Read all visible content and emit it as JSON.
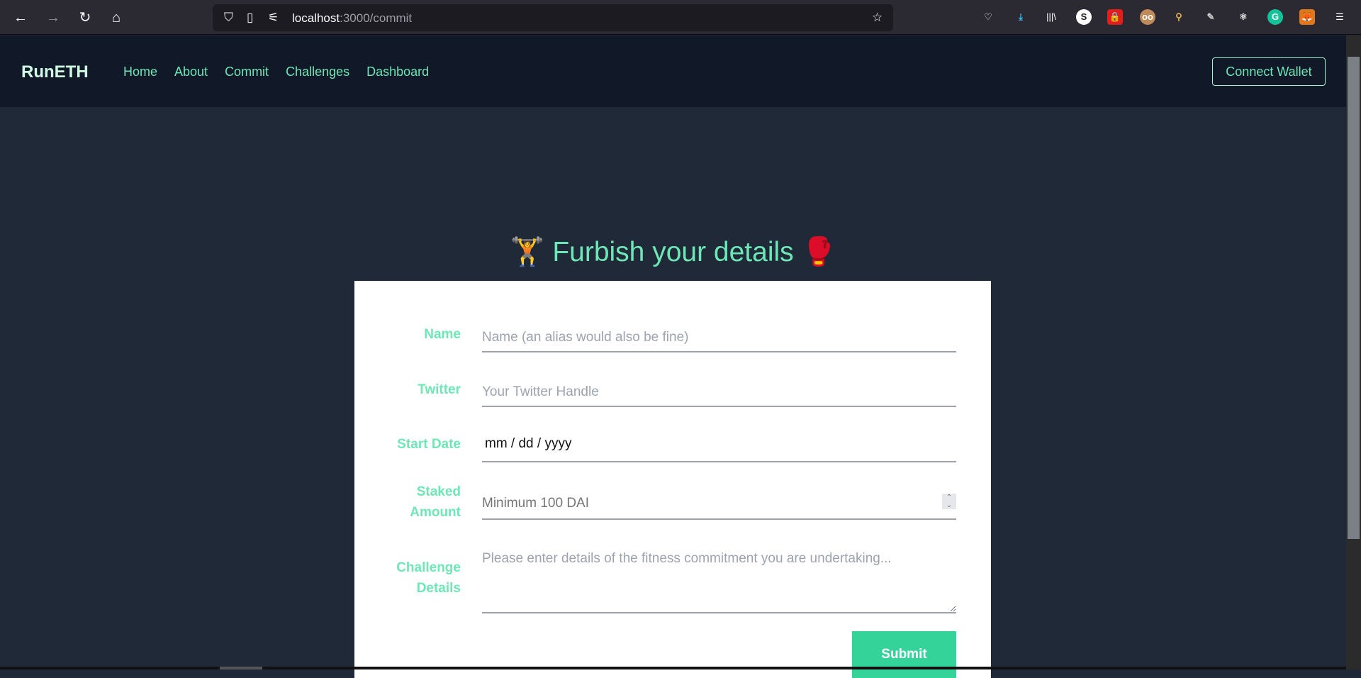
{
  "browser": {
    "url_host": "localhost",
    "url_path": ":3000/commit",
    "extensions": [
      "pocket-icon",
      "download-icon",
      "library-icon",
      "s-extension-icon",
      "lock-shield-icon",
      "glasses-avatar-icon",
      "broom-icon",
      "pen-icon",
      "react-icon",
      "grammarly-icon",
      "metamask-fox-icon",
      "menu-icon"
    ]
  },
  "nav": {
    "logo": "RunETH",
    "links": [
      "Home",
      "About",
      "Commit",
      "Challenges",
      "Dashboard"
    ],
    "connect_label": "Connect Wallet"
  },
  "page": {
    "title": "Furbish your details",
    "title_emoji_left": "🏋️",
    "title_emoji_right": "🥊"
  },
  "form": {
    "name": {
      "label": "Name",
      "placeholder": "Name (an alias would also be fine)"
    },
    "twitter": {
      "label": "Twitter",
      "placeholder": "Your Twitter Handle"
    },
    "start_date": {
      "label": "Start Date",
      "value": "mm / dd / yyyy"
    },
    "staked": {
      "label1": "Staked",
      "label2": "Amount",
      "placeholder": "Minimum 100 DAI"
    },
    "details": {
      "label1": "Challenge",
      "label2": "Details",
      "placeholder": "Please enter details of the fitness commitment you are undertaking..."
    },
    "submit_label": "Submit"
  },
  "colors": {
    "accent": "#6ee7b7",
    "button": "#34d399",
    "nav_bg": "#111827",
    "page_bg": "#1f2937"
  }
}
